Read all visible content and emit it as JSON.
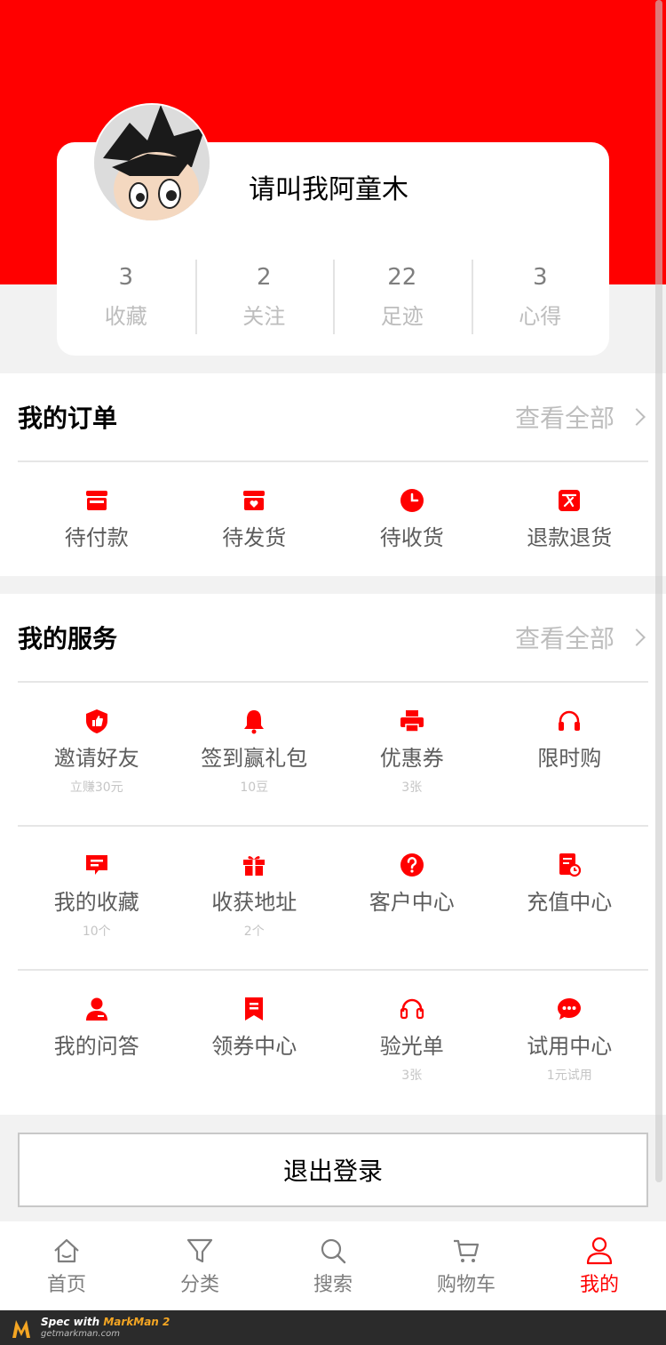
{
  "profile": {
    "username": "请叫我阿童木",
    "stats": [
      {
        "value": "3",
        "label": "收藏"
      },
      {
        "value": "2",
        "label": "关注"
      },
      {
        "value": "22",
        "label": "足迹"
      },
      {
        "value": "3",
        "label": "心得"
      }
    ]
  },
  "orders": {
    "title": "我的订单",
    "more": "查看全部",
    "items": [
      {
        "label": "待付款",
        "icon": "store-icon"
      },
      {
        "label": "待发货",
        "icon": "shop-heart-icon"
      },
      {
        "label": "待收货",
        "icon": "clock-icon"
      },
      {
        "label": "退款退货",
        "icon": "refund-icon"
      }
    ]
  },
  "services": {
    "title": "我的服务",
    "more": "查看全部",
    "rows": [
      [
        {
          "label": "邀请好友",
          "sub": "立赚30元",
          "icon": "thumbs-up-shield-icon"
        },
        {
          "label": "签到赢礼包",
          "sub": "10豆",
          "icon": "bell-icon"
        },
        {
          "label": "优惠券",
          "sub": "3张",
          "icon": "printer-icon"
        },
        {
          "label": "限时购",
          "sub": "",
          "icon": "headphones-icon"
        }
      ],
      [
        {
          "label": "我的收藏",
          "sub": "10个",
          "icon": "message-icon"
        },
        {
          "label": "收获地址",
          "sub": "2个",
          "icon": "gift-icon"
        },
        {
          "label": "客户中心",
          "sub": "",
          "icon": "question-icon"
        },
        {
          "label": "充值中心",
          "sub": "",
          "icon": "document-clock-icon"
        }
      ],
      [
        {
          "label": "我的问答",
          "sub": "",
          "icon": "user-icon"
        },
        {
          "label": "领券中心",
          "sub": "",
          "icon": "bookmark-icon"
        },
        {
          "label": "验光单",
          "sub": "3张",
          "icon": "headset-icon"
        },
        {
          "label": "试用中心",
          "sub": "1元试用",
          "icon": "chat-bubble-icon"
        }
      ]
    ]
  },
  "logout": {
    "label": "退出登录"
  },
  "tabbar": [
    {
      "label": "首页",
      "icon": "home-icon",
      "active": false
    },
    {
      "label": "分类",
      "icon": "filter-icon",
      "active": false
    },
    {
      "label": "搜索",
      "icon": "search-icon",
      "active": false
    },
    {
      "label": "购物车",
      "icon": "cart-icon",
      "active": false
    },
    {
      "label": "我的",
      "icon": "user-outline-icon",
      "active": true
    }
  ],
  "footer": {
    "line1a": "Spec with ",
    "line1b": "MarkMan 2",
    "line2": "getmarkman.com"
  },
  "colors": {
    "accent": "#ff0000",
    "stat_num": "#7e7e7e",
    "stat_label": "#bdbdbd",
    "item_text": "#5c5c5c",
    "sub_text": "#c5c5c5",
    "bg": "#f2f2f2"
  }
}
